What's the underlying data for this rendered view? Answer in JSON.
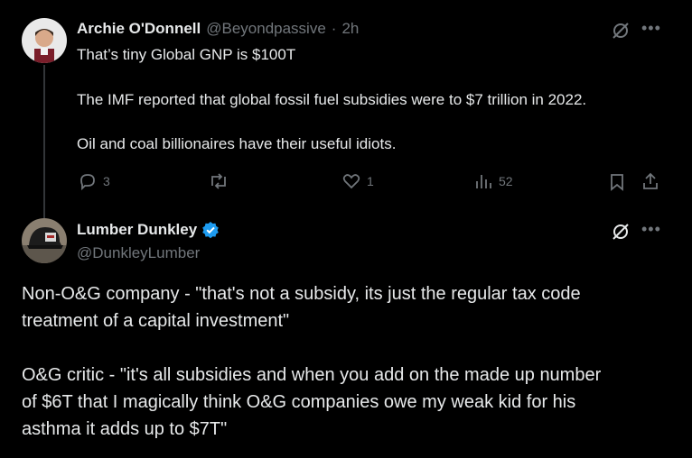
{
  "reply": {
    "author_name": "Archie O'Donnell",
    "handle": "@Beyondpassive",
    "separator": "·",
    "time": "2h",
    "lines": [
      "That’s tiny Global GNP is $100T",
      "The IMF reported that global fossil fuel subsidies were to $7 trillion in 2022.",
      "Oil and coal billionaires have their useful idiots."
    ],
    "actions": {
      "replies": "3",
      "likes": "1",
      "views": "52"
    }
  },
  "main": {
    "author_name": "Lumber Dunkley",
    "handle": "@DunkleyLumber",
    "verified_color": "#1d9bf0",
    "lines": [
      "Non-O&G company - \"that's not a subsidy, its just the regular tax code",
      "treatment of a capital investment\"",
      "O&G critic - \"it's all subsidies and when you add on the made up number",
      "of $6T that I magically think O&G  companies owe my weak kid for his",
      "asthma it adds up to $7T\""
    ]
  }
}
